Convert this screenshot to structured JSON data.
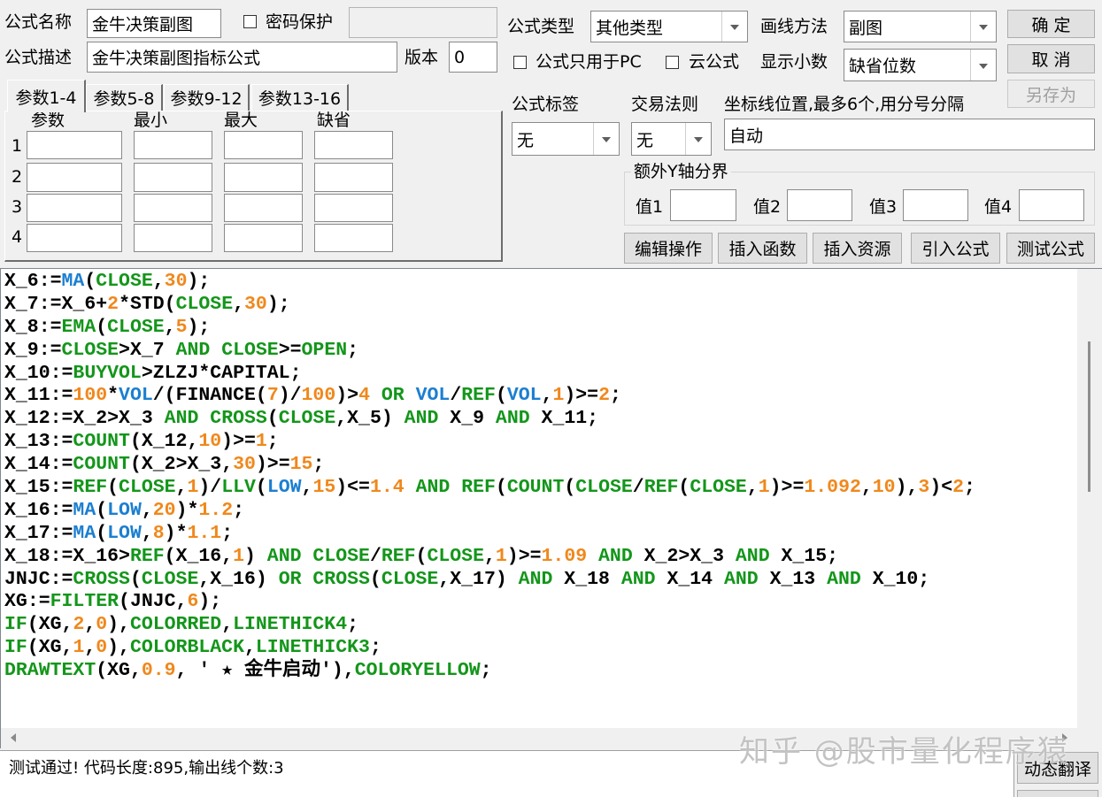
{
  "header": {
    "formula_name": {
      "label": "公式名称",
      "value": "金牛决策副图"
    },
    "password_protect": {
      "label": "密码保护",
      "checked": false,
      "value": ""
    },
    "description": {
      "label": "公式描述",
      "value": "金牛决策副图指标公式"
    },
    "version": {
      "label": "版本",
      "value": "0"
    }
  },
  "params": {
    "tabs": [
      {
        "label": "参数1-4",
        "active": true
      },
      {
        "label": "参数5-8",
        "active": false
      },
      {
        "label": "参数9-12",
        "active": false
      },
      {
        "label": "参数13-16",
        "active": false
      }
    ],
    "columns": [
      "参数",
      "最小",
      "最大",
      "缺省"
    ],
    "rows": [
      {
        "index": "1",
        "name": "",
        "min": "",
        "max": "",
        "default": ""
      },
      {
        "index": "2",
        "name": "",
        "min": "",
        "max": "",
        "default": ""
      },
      {
        "index": "3",
        "name": "",
        "min": "",
        "max": "",
        "default": ""
      },
      {
        "index": "4",
        "name": "",
        "min": "",
        "max": "",
        "default": ""
      }
    ]
  },
  "settings": {
    "formula_type": {
      "label": "公式类型",
      "value": "其他类型"
    },
    "draw_method": {
      "label": "画线方法",
      "value": "副图"
    },
    "pc_only": {
      "label": "公式只用于PC",
      "checked": false
    },
    "cloud": {
      "label": "云公式",
      "checked": false
    },
    "decimals": {
      "label": "显示小数",
      "value": "缺省位数"
    },
    "tag": {
      "label": "公式标签",
      "value": "无"
    },
    "trade_rule": {
      "label": "交易法则",
      "value": "无"
    },
    "axis_lines": {
      "label": "坐标线位置,最多6个,用分号分隔",
      "value": "自动"
    },
    "extra_y_axis": {
      "label": "额外Y轴分界",
      "values": [
        {
          "label": "值1",
          "value": ""
        },
        {
          "label": "值2",
          "value": ""
        },
        {
          "label": "值3",
          "value": ""
        },
        {
          "label": "值4",
          "value": ""
        }
      ]
    }
  },
  "buttons": {
    "ok": {
      "label": "确 定"
    },
    "cancel": {
      "label": "取 消"
    },
    "save_as": {
      "label": "另存为",
      "disabled": true
    },
    "edit_ops": {
      "label": "编辑操作"
    },
    "insert_function": {
      "label": "插入函数"
    },
    "insert_resource": {
      "label": "插入资源"
    },
    "import_formula": {
      "label": "引入公式"
    },
    "test_formula": {
      "label": "测试公式"
    },
    "dynamic_translate": {
      "label": "动态翻译"
    }
  },
  "editor": {
    "lines": [
      "X_6:=MA(CLOSE,30);",
      "X_7:=X_6+2*STD(CLOSE,30);",
      "X_8:=EMA(CLOSE,5);",
      "X_9:=CLOSE>X_7 AND CLOSE>=OPEN;",
      "X_10:=BUYVOL>ZLZJ*CAPITAL;",
      "X_11:=100*VOL/(FINANCE(7)/100)>4 OR VOL/REF(VOL,1)>=2;",
      "X_12:=X_2>X_3 AND CROSS(CLOSE,X_5) AND X_9 AND X_11;",
      "X_13:=COUNT(X_12,10)>=1;",
      "X_14:=COUNT(X_2>X_3,30)>=15;",
      "X_15:=REF(CLOSE,1)/LLV(LOW,15)<=1.4 AND REF(COUNT(CLOSE/REF(CLOSE,1)>=1.092,10),3)<2;",
      "X_16:=MA(LOW,20)*1.2;",
      "X_17:=MA(LOW,8)*1.1;",
      "X_18:=X_16>REF(X_16,1) AND CLOSE/REF(CLOSE,1)>=1.09 AND X_2>X_3 AND X_15;",
      "JNJC:=CROSS(CLOSE,X_16) OR CROSS(CLOSE,X_17) AND X_18 AND X_14 AND X_13 AND X_10;",
      "XG:=FILTER(JNJC,6);",
      "IF(XG,2,0),COLORRED,LINETHICK4;",
      "IF(XG,1,0),COLORBLACK,LINETHICK3;",
      "DRAWTEXT(XG,0.9, ' ★ 金牛启动'),COLORYELLOW;"
    ],
    "syntax_colors": {
      "keyword": "#13961a",
      "data_function": "#1b7fd1",
      "number": "#f0881c",
      "default": "#000000"
    }
  },
  "status": {
    "message": "测试通过! 代码长度:895,输出线个数:3"
  },
  "watermark": {
    "text": "知乎 @股市量化程序猿"
  }
}
